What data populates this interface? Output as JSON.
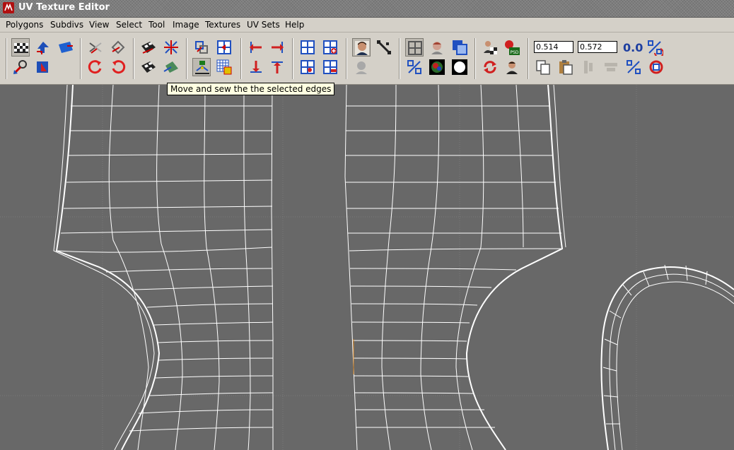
{
  "window": {
    "title": "UV Texture Editor",
    "icon": "maya-app-icon"
  },
  "menu": [
    "Polygons",
    "Subdivs",
    "View",
    "Select",
    "Tool",
    "Image",
    "Textures",
    "UV Sets",
    "Help"
  ],
  "toolbar": {
    "u_value": "0.514",
    "v_value": "0.572",
    "zero_label": "0.0",
    "icons": [
      "checker-display-icon",
      "flip-u-icon",
      "flip-v-icon",
      "pin-icon",
      "unfold-icon",
      "cut-icon",
      "sew-icon",
      "rotate-ccw-icon",
      "rotate-cw-icon",
      "checker-arrow-icon",
      "checker-scale-icon",
      "move-sew-icon",
      "layout-icon",
      "fold-icon",
      "grid-snap-icon",
      "align-left-icon",
      "align-right-icon",
      "align-bottom-icon",
      "align-top-icon",
      "grid-icon",
      "grid-add-icon",
      "grid-remove-icon",
      "grid-select-icon",
      "face-icon",
      "face-gray-icon",
      "diagonal-icon",
      "toggle-grid-icon",
      "shaded-icon",
      "copy-icon",
      "filter-icon",
      "display-icon",
      "circle-icon",
      "percent-icon",
      "photoshop-icon",
      "refresh-icon",
      "person-icon",
      "paste-icon",
      "copy-uvs-icon",
      "paste-uvs-icon",
      "align-icon",
      "swap-icon",
      "cycle-icon"
    ]
  },
  "tooltip": "Move and sew the the selected edges",
  "viewport": {
    "background": "#686868",
    "wire_color": "#ffffff",
    "grid_color": "#7c7c7c"
  }
}
